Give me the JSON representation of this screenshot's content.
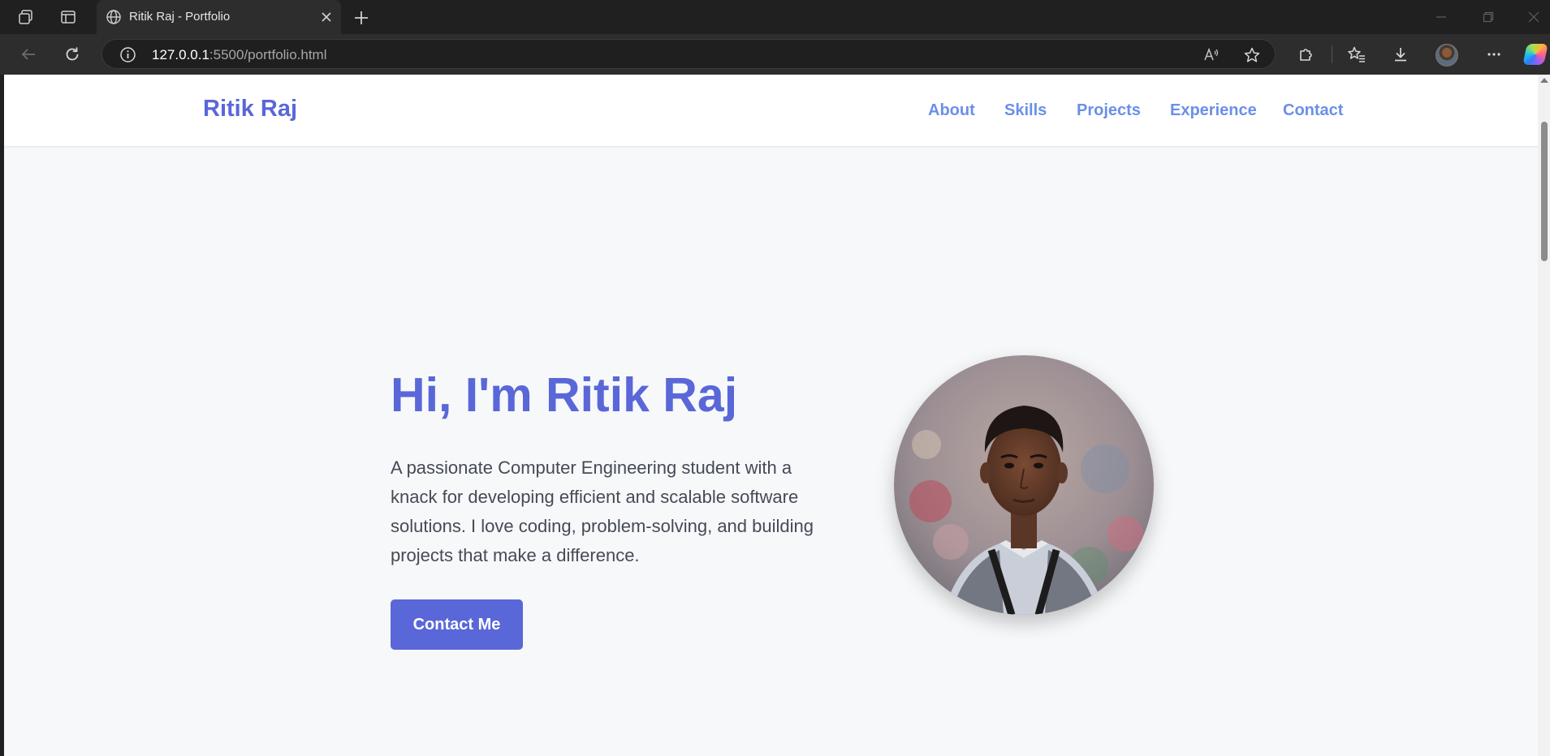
{
  "browser": {
    "tab": {
      "title": "Ritik Raj - Portfolio"
    },
    "address": {
      "host": "127.0.0.1",
      "rest": ":5500/portfolio.html"
    },
    "icons": {
      "workspaces": "workspaces-icon",
      "tab_actions": "tab-actions-icon",
      "globe": "globe-icon",
      "close": "close-icon",
      "new_tab": "plus-icon",
      "back": "back-arrow-icon",
      "refresh": "refresh-icon",
      "info": "info-icon",
      "read_aloud": "read-aloud-icon",
      "favorite": "star-icon",
      "extensions": "puzzle-icon",
      "favorites": "favorites-icon",
      "downloads": "download-icon",
      "menu": "ellipsis-icon",
      "copilot": "copilot-icon"
    }
  },
  "site": {
    "logo": "Ritik Raj",
    "nav": [
      "About",
      "Skills",
      "Projects",
      "Experience",
      "Contact"
    ],
    "hero": {
      "title": "Hi, I'm Ritik Raj",
      "description": "A passionate Computer Engineering student with a knack for developing efficient and scalable software solutions. I love coding, problem-solving, and building projects that make a difference.",
      "cta": "Contact Me"
    }
  },
  "colors": {
    "accent": "#5a67d8",
    "nav_link": "#6b8fe8",
    "page_bg": "#f7f8fa",
    "text": "#444b55"
  }
}
